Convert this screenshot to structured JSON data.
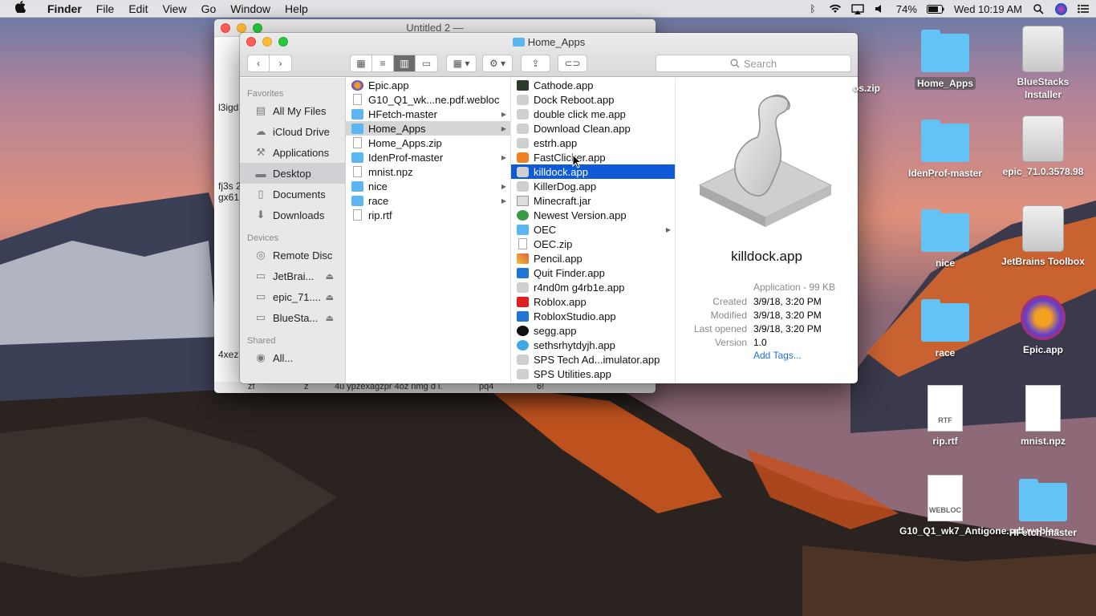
{
  "menubar": {
    "apple": "",
    "app": "Finder",
    "items": [
      "File",
      "Edit",
      "View",
      "Go",
      "Window",
      "Help"
    ],
    "battery": "74%",
    "clock": "Wed 10:19 AM"
  },
  "bg_window": {
    "title": "Untitled 2 —",
    "fragments": [
      "l3igd",
      "fj3s 2",
      "gx61",
      "4xez"
    ],
    "bottom_text": [
      "zf",
      "z",
      "4u ypzexagzpr 4oz  nmg d i.",
      "pq4",
      "6!"
    ]
  },
  "finder": {
    "title": "Home_Apps",
    "search_placeholder": "Search",
    "sidebar": {
      "favorites_head": "Favorites",
      "favorites": [
        {
          "label": "All My Files",
          "icon": "all-files-icon"
        },
        {
          "label": "iCloud Drive",
          "icon": "cloud-icon"
        },
        {
          "label": "Applications",
          "icon": "applications-icon"
        },
        {
          "label": "Desktop",
          "icon": "desktop-icon"
        },
        {
          "label": "Documents",
          "icon": "documents-icon"
        },
        {
          "label": "Downloads",
          "icon": "downloads-icon"
        }
      ],
      "devices_head": "Devices",
      "devices": [
        {
          "label": "Remote Disc"
        },
        {
          "label": "JetBrai..."
        },
        {
          "label": "epic_71...."
        },
        {
          "label": "BlueSta..."
        }
      ],
      "shared_head": "Shared",
      "shared": [
        {
          "label": "All..."
        }
      ]
    },
    "col1": [
      {
        "label": "Epic.app",
        "kind": "round"
      },
      {
        "label": "G10_Q1_wk...ne.pdf.webloc",
        "kind": "doc"
      },
      {
        "label": "HFetch-master",
        "kind": "folder",
        "arrow": true
      },
      {
        "label": "Home_Apps",
        "kind": "folder",
        "arrow": true
      },
      {
        "label": "Home_Apps.zip",
        "kind": "doc"
      },
      {
        "label": "IdenProf-master",
        "kind": "folder",
        "arrow": true
      },
      {
        "label": "mnist.npz",
        "kind": "doc"
      },
      {
        "label": "nice",
        "kind": "folder",
        "arrow": true
      },
      {
        "label": "race",
        "kind": "folder",
        "arrow": true
      },
      {
        "label": "rip.rtf",
        "kind": "doc"
      }
    ],
    "col2": [
      {
        "label": "Cathode.app",
        "kind": "dark"
      },
      {
        "label": "Dock Reboot.app",
        "kind": "app"
      },
      {
        "label": "double click me.app",
        "kind": "app"
      },
      {
        "label": "Download Clean.app",
        "kind": "app"
      },
      {
        "label": "estrh.app",
        "kind": "app"
      },
      {
        "label": "FastClicker.app",
        "kind": "orange"
      },
      {
        "label": "killdock.app",
        "kind": "app"
      },
      {
        "label": "KillerDog.app",
        "kind": "app"
      },
      {
        "label": "Minecraft.jar",
        "kind": "jar"
      },
      {
        "label": "Newest Version.app",
        "kind": "green"
      },
      {
        "label": "OEC",
        "kind": "folder",
        "arrow": true
      },
      {
        "label": "OEC.zip",
        "kind": "doc"
      },
      {
        "label": "Pencil.app",
        "kind": "pencil"
      },
      {
        "label": "Quit Finder.app",
        "kind": "blue"
      },
      {
        "label": "r4nd0m g4rb1e.app",
        "kind": "app"
      },
      {
        "label": "Roblox.app",
        "kind": "red"
      },
      {
        "label": "RobloxStudio.app",
        "kind": "blue"
      },
      {
        "label": "segg.app",
        "kind": "black"
      },
      {
        "label": "sethsrhytdyjh.app",
        "kind": "cyan"
      },
      {
        "label": "SPS Tech Ad...imulator.app",
        "kind": "app"
      },
      {
        "label": "SPS Utilities.app",
        "kind": "app"
      }
    ],
    "preview": {
      "name": "killdock.app",
      "kind": "Application - 99 KB",
      "created_label": "Created",
      "created": "3/9/18, 3:20 PM",
      "modified_label": "Modified",
      "modified": "3/9/18, 3:20 PM",
      "opened_label": "Last opened",
      "opened": "3/9/18, 3:20 PM",
      "version_label": "Version",
      "version": "1.0",
      "add_tags": "Add Tags..."
    }
  },
  "desktop": {
    "partial_label": "os.zip",
    "icons": [
      {
        "label": "Home_Apps",
        "type": "folder"
      },
      {
        "label": "BlueStacks Installer",
        "type": "disk"
      },
      {
        "label": "IdenProf-master",
        "type": "folder"
      },
      {
        "label": "epic_71.0.3578.98",
        "type": "disk"
      },
      {
        "label": "nice",
        "type": "folder"
      },
      {
        "label": "JetBrains Toolbox",
        "type": "disk"
      },
      {
        "label": "race",
        "type": "folder"
      },
      {
        "label": "Epic.app",
        "type": "app"
      },
      {
        "label": "rip.rtf",
        "type": "doc",
        "badge": "RTF"
      },
      {
        "label": "mnist.npz",
        "type": "doc",
        "badge": ""
      },
      {
        "label": "G10_Q1_wk7_Antigone.pdf.webloc",
        "type": "doc",
        "badge": "WEBLOC"
      },
      {
        "label": "HFetch-master",
        "type": "folder"
      }
    ]
  }
}
